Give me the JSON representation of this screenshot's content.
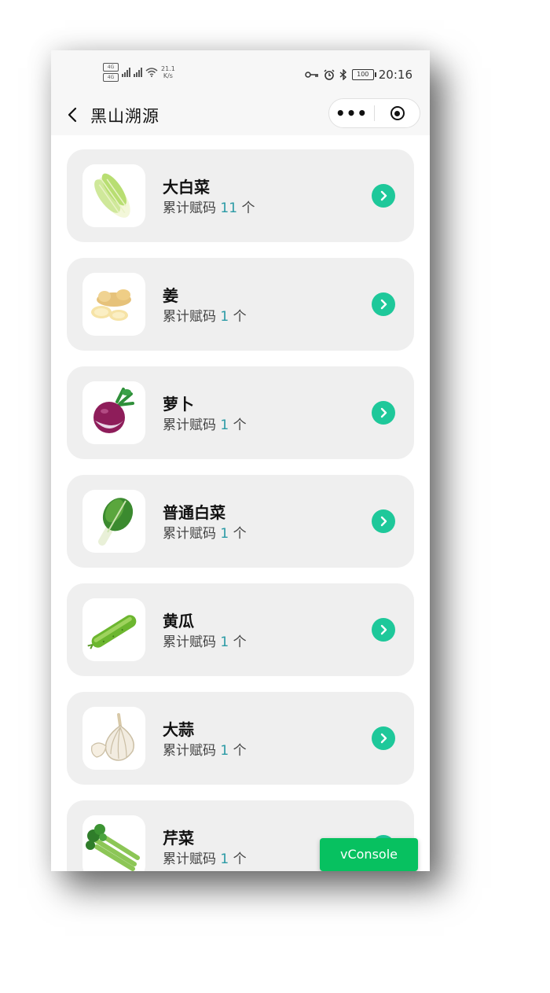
{
  "status_bar": {
    "sim1": "4G",
    "sim2": "4G",
    "net_speed_value": "21.1",
    "net_speed_unit": "K/s",
    "battery": "100",
    "time": "20:16"
  },
  "navbar": {
    "title": "黑山溯源",
    "more_label": "•••"
  },
  "items": [
    {
      "name": "大白菜",
      "count_prefix": "累计赋码",
      "count": "11",
      "count_suffix": "个",
      "icon": "napa-cabbage-icon"
    },
    {
      "name": "姜",
      "count_prefix": "累计赋码",
      "count": "1",
      "count_suffix": "个",
      "icon": "ginger-icon"
    },
    {
      "name": "萝卜",
      "count_prefix": "累计赋码",
      "count": "1",
      "count_suffix": "个",
      "icon": "radish-icon"
    },
    {
      "name": "普通白菜",
      "count_prefix": "累计赋码",
      "count": "1",
      "count_suffix": "个",
      "icon": "bok-choy-icon"
    },
    {
      "name": "黄瓜",
      "count_prefix": "累计赋码",
      "count": "1",
      "count_suffix": "个",
      "icon": "cucumber-icon"
    },
    {
      "name": "大蒜",
      "count_prefix": "累计赋码",
      "count": "1",
      "count_suffix": "个",
      "icon": "garlic-icon"
    },
    {
      "name": "芹菜",
      "count_prefix": "累计赋码",
      "count": "1",
      "count_suffix": "个",
      "icon": "celery-icon"
    }
  ],
  "vconsole_label": "vConsole",
  "colors": {
    "accent_green": "#1ec89a",
    "count_number": "#2a9aa5",
    "vconsole_green": "#07c160",
    "card_bg": "#efefef"
  }
}
